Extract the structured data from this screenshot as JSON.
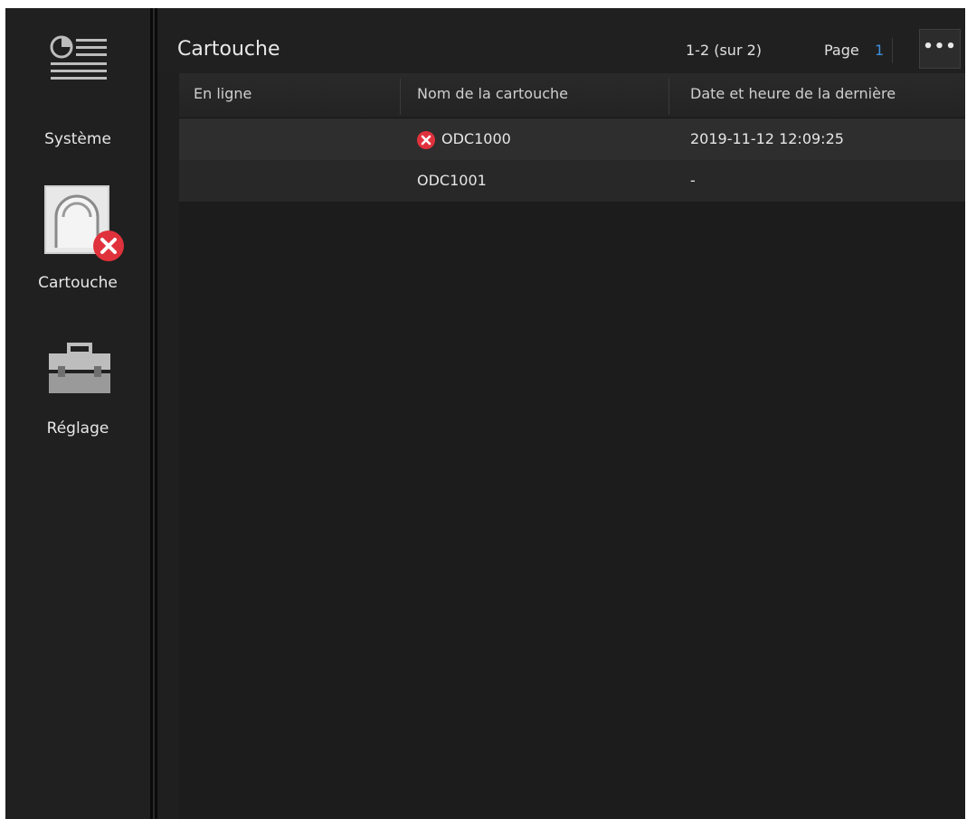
{
  "sidebar": {
    "items": [
      {
        "label": "Système",
        "icon": "system-list-icon"
      },
      {
        "label": "Cartouche",
        "icon": "cartridge-error-icon"
      },
      {
        "label": "Réglage",
        "icon": "toolbox-icon"
      }
    ]
  },
  "header": {
    "title": "Cartouche",
    "count": "1-2 (sur 2)",
    "page_label": "Page",
    "page_number": "1",
    "more_label": "•••"
  },
  "table": {
    "columns": [
      "En ligne",
      "Nom de la cartouche",
      "Date et heure de la dernière"
    ],
    "rows": [
      {
        "online": "",
        "name": "ODC1000",
        "status_icon": "error-icon",
        "datetime": "2019-11-12 12:09:25"
      },
      {
        "online": "",
        "name": "ODC1001",
        "status_icon": "",
        "datetime": "-"
      }
    ]
  },
  "colors": {
    "background": "#1f1f1f",
    "error": "#e0323c",
    "accent": "#3e8ed8",
    "text": "#e6e6e6"
  }
}
